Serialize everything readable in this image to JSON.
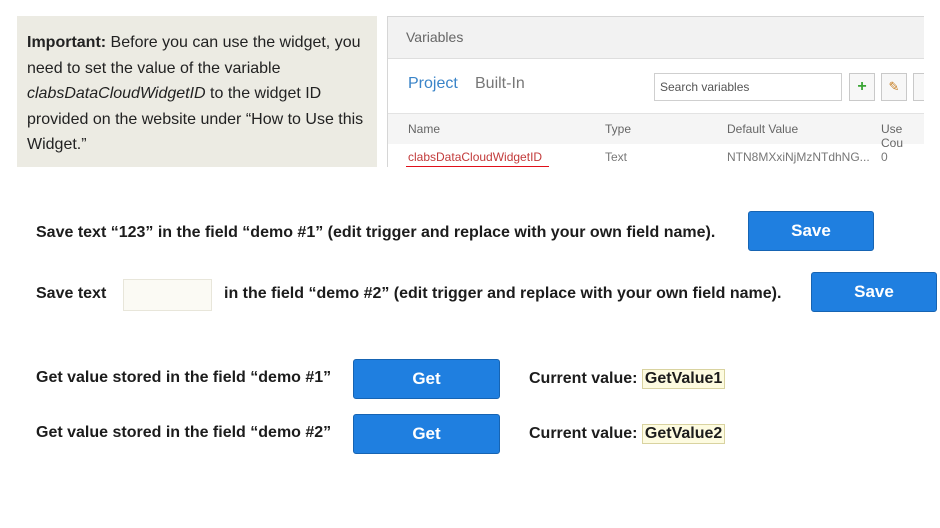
{
  "note": {
    "important_label": "Important:",
    "text_1": " Before you can use the widget, you need to set the value of the variable ",
    "variable_name": "clabsDataCloudWidgetID",
    "text_2": " to the widget ID provided on the website under “How to Use this Widget.”"
  },
  "variables_panel": {
    "title": "Variables",
    "tabs": [
      "Project",
      "Built-In"
    ],
    "search_placeholder": "Search variables",
    "columns": [
      "Name",
      "Type",
      "Default Value",
      "Use Cou"
    ],
    "row": {
      "name": "clabsDataCloudWidgetID",
      "type": "Text",
      "default_value": "NTN8MXxiNjMzNTdhNG...",
      "use_count": "0"
    }
  },
  "save1": {
    "text": "Save text “123” in the field “demo #1” (edit trigger and replace with your own field name).",
    "button": "Save"
  },
  "save2": {
    "text_before": "Save text",
    "text_after": "in the field “demo #2” (edit trigger and replace with your own field name).",
    "input_value": "",
    "button": "Save"
  },
  "get1": {
    "text": "Get value stored in the field “demo #1”",
    "button": "Get",
    "current_label": "Current value:",
    "current_value": "GetValue1"
  },
  "get2": {
    "text": "Get value stored in the field “demo #2”",
    "button": "Get",
    "current_label": "Current value:",
    "current_value": "GetValue2"
  },
  "colors": {
    "accent": "#1f7fe0",
    "note_background": "#ecebe3",
    "underline": "#e0101a"
  }
}
